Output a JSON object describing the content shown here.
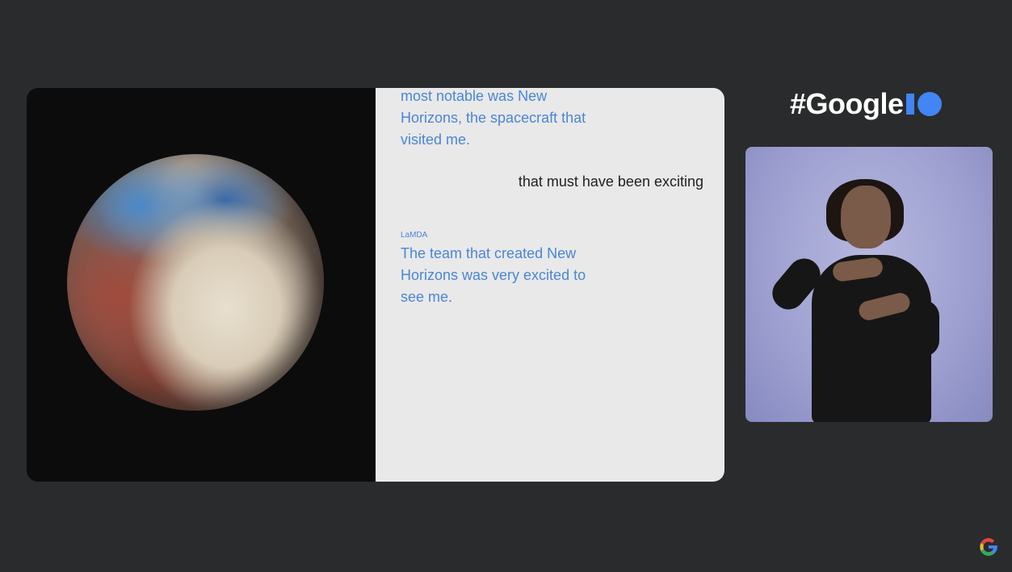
{
  "conversation": {
    "ai_message_1": "most notable was New Horizons, the spacecraft that visited me.",
    "user_message": "that must have been exciting",
    "ai_label": "LaMDA",
    "ai_message_2": "The team that created New Horizons was very excited to see me."
  },
  "branding": {
    "hashtag_text": "#Google",
    "accent_color": "#4285f4"
  },
  "colors": {
    "background": "#2a2b2c",
    "ai_text": "#4a86d4",
    "user_text": "#202124",
    "text_panel": "#e9e9ea"
  },
  "icons": {
    "corner_logo": "google-g-icon"
  }
}
